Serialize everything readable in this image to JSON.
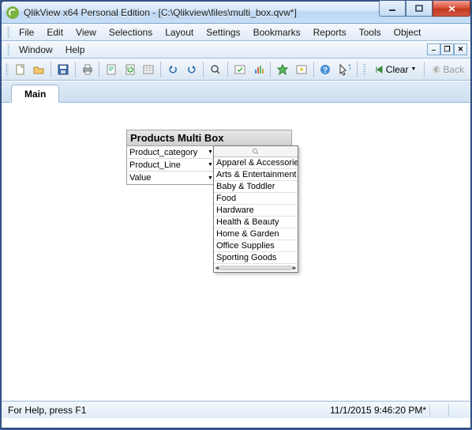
{
  "title": "QlikView x64 Personal Edition - [C:\\Qlikview\\files\\multi_box.qvw*]",
  "menu": {
    "file": "File",
    "edit": "Edit",
    "view": "View",
    "selections": "Selections",
    "layout": "Layout",
    "settings": "Settings",
    "bookmarks": "Bookmarks",
    "reports": "Reports",
    "tools": "Tools",
    "object": "Object",
    "window": "Window",
    "help": "Help"
  },
  "toolbar": {
    "clear": "Clear",
    "back": "Back"
  },
  "tabs": {
    "main": "Main"
  },
  "multibox": {
    "title": "Products Multi Box",
    "fields": [
      {
        "label": "Product_category"
      },
      {
        "label": "Product_Line"
      },
      {
        "label": "Value"
      }
    ],
    "dropdown": [
      "Apparel & Accessories",
      "Arts & Entertainment",
      "Baby & Toddler",
      "Food",
      "Hardware",
      "Health & Beauty",
      "Home & Garden",
      "Office Supplies",
      "Sporting Goods"
    ]
  },
  "status": {
    "help": "For Help, press F1",
    "datetime": "11/1/2015 9:46:20 PM*"
  }
}
